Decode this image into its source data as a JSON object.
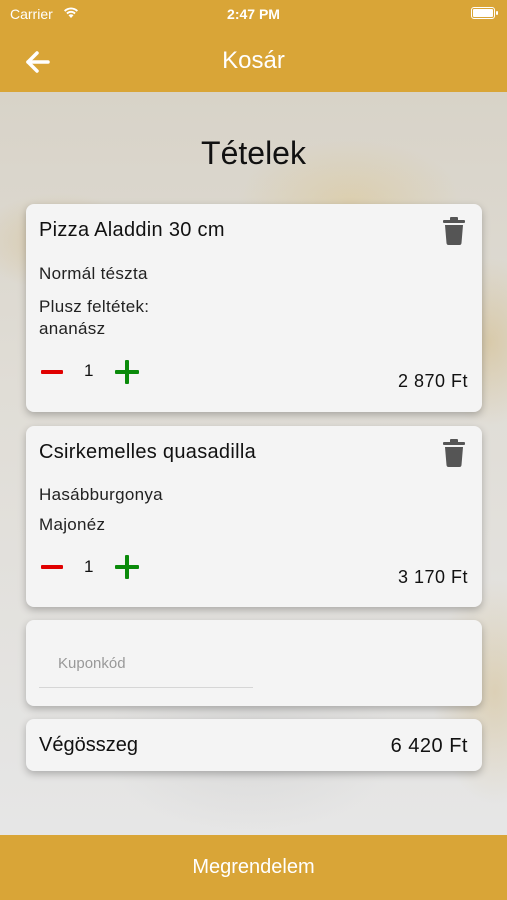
{
  "status_bar": {
    "carrier": "Carrier",
    "time": "2:47 PM"
  },
  "nav": {
    "title": "Kosár",
    "back_icon": "arrow-left-icon"
  },
  "heading": "Tételek",
  "items": [
    {
      "name": "Pizza Aladdin 30 cm",
      "options": [
        "Normál tészta",
        "Plusz feltétek:",
        "ananász"
      ],
      "quantity": "1",
      "price": "2 870 Ft"
    },
    {
      "name": "Csirkemelles quasadilla",
      "options": [
        "Hasábburgonya",
        "Majonéz"
      ],
      "quantity": "1",
      "price": "3 170 Ft"
    }
  ],
  "coupon": {
    "placeholder": "Kuponkód",
    "value": ""
  },
  "total": {
    "label": "Végösszeg",
    "value": "6 420 Ft"
  },
  "order_button": "Megrendelem",
  "colors": {
    "accent": "#D9A537",
    "minus": "#E00000",
    "plus": "#0A8A0A",
    "trash": "#555555"
  }
}
